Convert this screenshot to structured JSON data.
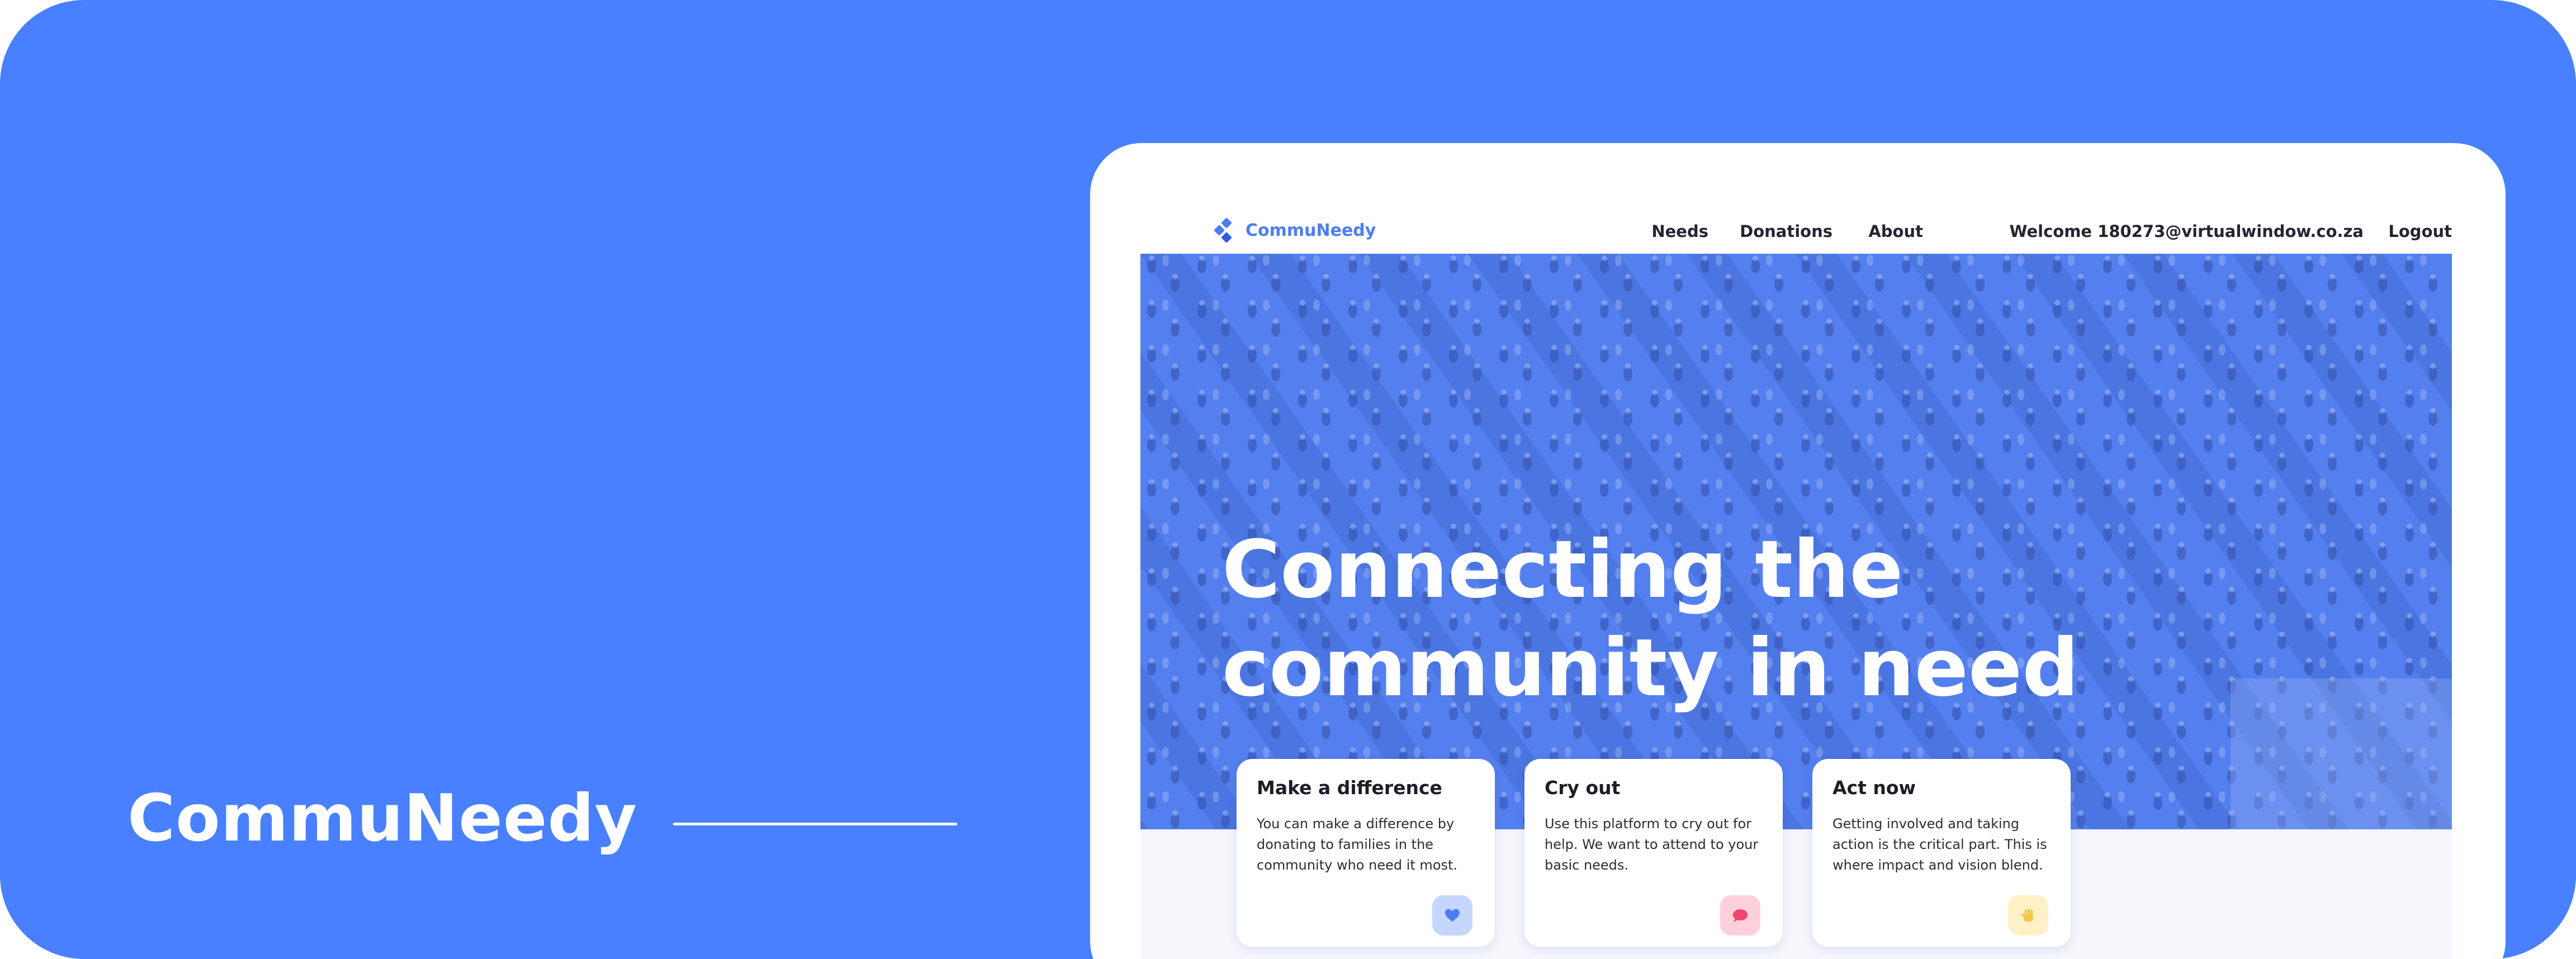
{
  "branding": {
    "title": "CommuNeedy"
  },
  "nav": {
    "logo_text": "CommuNeedy",
    "links": [
      {
        "label": "Needs"
      },
      {
        "label": "Donations"
      },
      {
        "label": "About"
      },
      {
        "label": "Welcome 180273@virtualwindow.co.za"
      },
      {
        "label": "Logout"
      }
    ]
  },
  "hero": {
    "title": "Connecting the community in need",
    "background_image": "crowd-of-people-aerial-photo"
  },
  "cards": [
    {
      "title": "Make a difference",
      "text": "You can make a difference by donating to families in the community who need it most.",
      "icon": "heart-icon",
      "icon_color": "#4d7df5",
      "badge_color": "#c5d6ff"
    },
    {
      "title": "Cry out",
      "text": "Use this platform to cry out for help. We want to attend to your basic needs.",
      "icon": "chat-bubble-icon",
      "icon_color": "#f0456e",
      "badge_color": "#ffd0da"
    },
    {
      "title": "Act now",
      "text": "Getting involved and taking action is the critical part. This is where impact and vision blend.",
      "icon": "raised-hand-icon",
      "icon_color": "#f5c74a",
      "badge_color": "#fff1c6"
    }
  ],
  "colors": {
    "brand_blue": "#4880ff",
    "hero_overlay": "#4d78e6",
    "text_dark": "#232533",
    "band_background": "#f4f6fc"
  }
}
